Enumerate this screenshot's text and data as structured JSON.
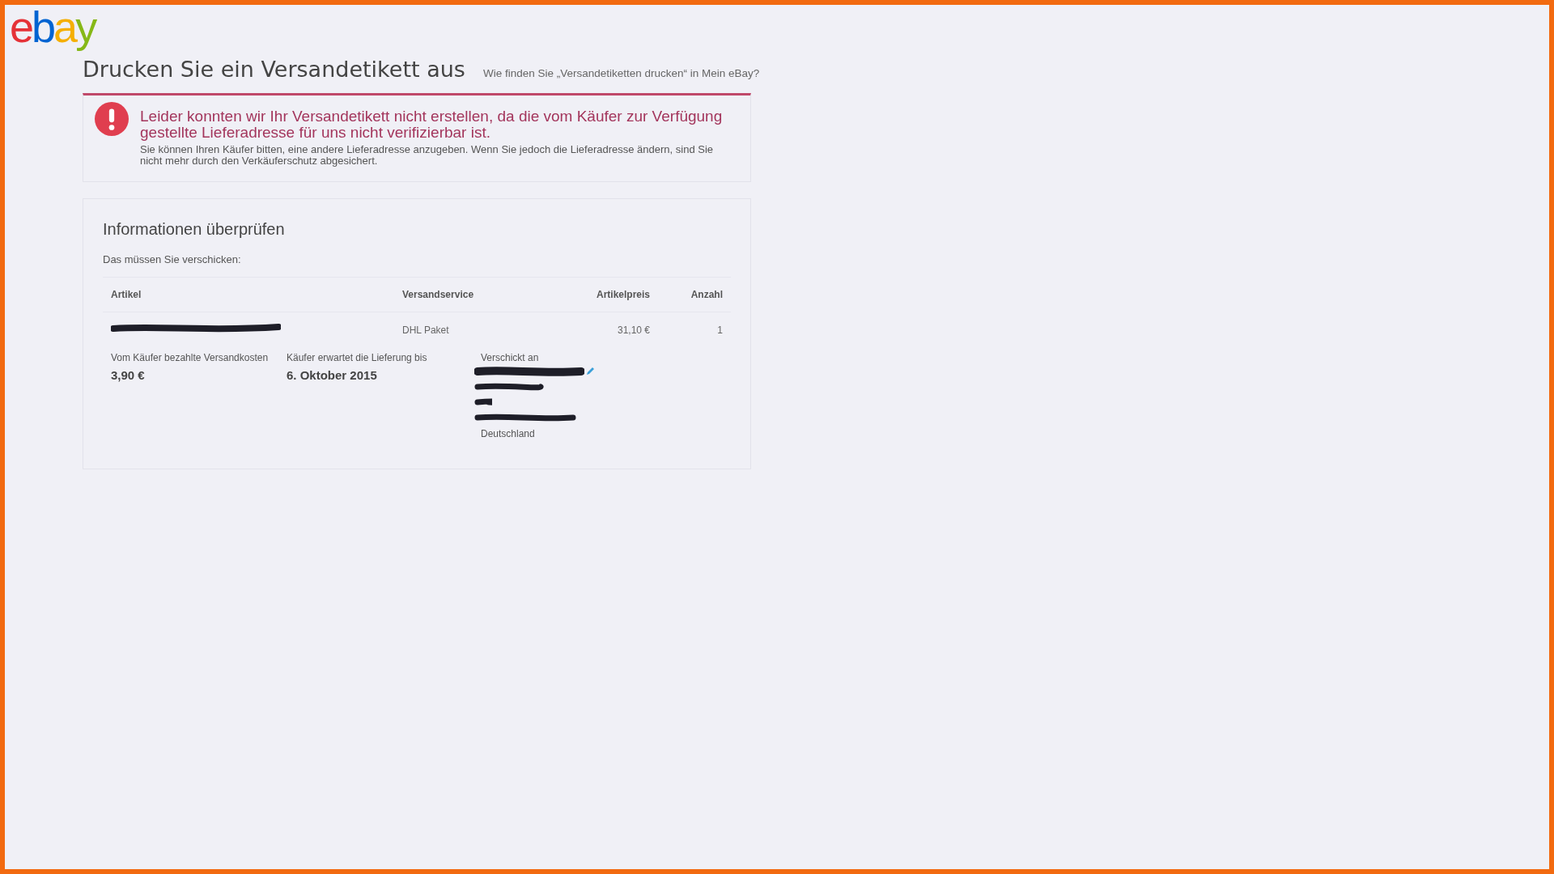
{
  "logo": {
    "letters": [
      {
        "char": "e",
        "color": "#e53238"
      },
      {
        "char": "b",
        "color": "#0064d2"
      },
      {
        "char": "a",
        "color": "#f5af02"
      },
      {
        "char": "y",
        "color": "#86b817"
      }
    ]
  },
  "page_title": "Drucken Sie ein Versandetikett aus",
  "help_link": "Wie finden Sie „Versandetiketten drucken“ in Mein eBay?",
  "alert": {
    "kind": "error",
    "title": "Leider konnten wir Ihr Versandetikett nicht erstellen, da die vom Käufer zur Verfügung gestellte Lieferadresse für uns nicht verifizierbar ist.",
    "message": "Sie können Ihren Käufer bitten, eine andere Lieferadresse anzugeben. Wenn Sie jedoch die Lieferadresse ändern, sind Sie nicht mehr durch den Verkäuferschutz abgesichert."
  },
  "review": {
    "title": "Informationen überprüfen",
    "subtitle": "Das müssen Sie verschicken:",
    "table": {
      "columns": [
        "Artikel",
        "Versandservice",
        "Artikelpreis",
        "Anzahl"
      ],
      "rows": [
        {
          "article_redacted": true,
          "service": "DHL Paket",
          "price": "31,10 €",
          "quantity": "1"
        }
      ]
    },
    "shipping_cost": {
      "label": "Vom Käufer bezahlte Versandkosten",
      "value": "3,90 €"
    },
    "delivery": {
      "label": "Käufer erwartet die Lieferung bis",
      "value": "6. Oktober 2015"
    },
    "ship_to": {
      "label": "Verschickt an",
      "address_redacted": true,
      "country": "Deutschland"
    }
  }
}
